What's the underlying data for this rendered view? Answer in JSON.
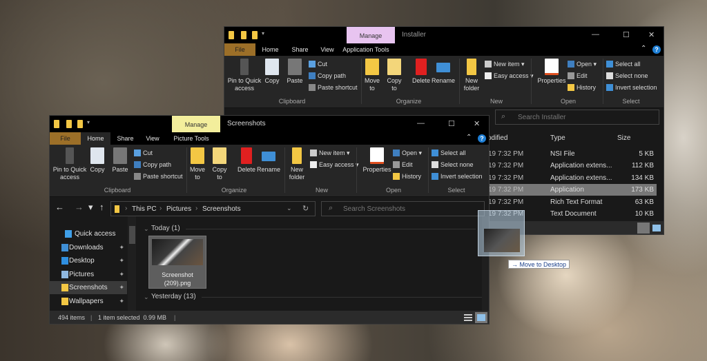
{
  "ribbon_common": {
    "clipboard": {
      "pin": "Pin to Quick access",
      "copy": "Copy",
      "paste": "Paste",
      "cut": "Cut",
      "copy_path": "Copy path",
      "paste_shortcut": "Paste shortcut",
      "label": "Clipboard"
    },
    "organize": {
      "move_to": "Move to",
      "copy_to": "Copy to",
      "delete": "Delete",
      "rename": "Rename",
      "label": "Organize"
    },
    "new": {
      "new_folder": "New folder",
      "new_item": "New item ▾",
      "easy_access": "Easy access ▾",
      "label": "New"
    },
    "open": {
      "properties": "Properties",
      "open": "Open ▾",
      "edit": "Edit",
      "history": "History",
      "label": "Open"
    },
    "select": {
      "select_all": "Select all",
      "select_none": "Select none",
      "invert_selection": "Invert selection",
      "label": "Select"
    }
  },
  "back_window": {
    "title": "Installer",
    "manage_tab": "Manage",
    "manage_color": "#e8c4f0",
    "tabs": [
      "File",
      "Home",
      "Share",
      "View",
      "Application Tools"
    ],
    "search_placeholder": "Search Installer",
    "columns": {
      "date": "odified",
      "type": "Type",
      "size": "Size"
    },
    "rows": [
      {
        "date": "19 7:32 PM",
        "type": "NSI File",
        "size": "5 KB"
      },
      {
        "date": "19 7:32 PM",
        "type": "Application extens...",
        "size": "112 KB"
      },
      {
        "date": "19 7:32 PM",
        "type": "Application extens...",
        "size": "134 KB"
      },
      {
        "date": "19 7:32 PM",
        "type": "Application",
        "size": "173 KB",
        "selected": true
      },
      {
        "date": "19 7:32 PM",
        "type": "Rich Text Format",
        "size": "63 KB"
      },
      {
        "date": "19 7:32 PM",
        "type": "Text Document",
        "size": "10 KB"
      }
    ]
  },
  "front_window": {
    "title": "Screenshots",
    "manage_tab": "Manage",
    "manage_color": "#f3ee9c",
    "tabs": [
      "File",
      "Home",
      "Share",
      "View",
      "Picture Tools"
    ],
    "active_tab": "Home",
    "breadcrumb": [
      "This PC",
      "Pictures",
      "Screenshots"
    ],
    "search_placeholder": "Search Screenshots",
    "nav": [
      {
        "label": "Quick access",
        "icon": "star-icon"
      },
      {
        "label": "Downloads",
        "icon": "download-icon",
        "pinned": true
      },
      {
        "label": "Desktop",
        "icon": "desktop-icon",
        "pinned": true
      },
      {
        "label": "Pictures",
        "icon": "pictures-icon",
        "pinned": true
      },
      {
        "label": "Screenshots",
        "icon": "folder-icon",
        "pinned": true,
        "selected": true
      },
      {
        "label": "Wallpapers",
        "icon": "folder-icon",
        "pinned": true
      }
    ],
    "groups": [
      {
        "label": "Today (1)"
      },
      {
        "label": "Yesterday (13)"
      }
    ],
    "file": {
      "name_line1": "Screenshot",
      "name_line2": "(209).png"
    },
    "status": {
      "items": "494 items",
      "selected": "1 item selected  0.99 MB"
    }
  },
  "drag": {
    "tooltip": "Move to Desktop",
    "arrow": "→"
  }
}
